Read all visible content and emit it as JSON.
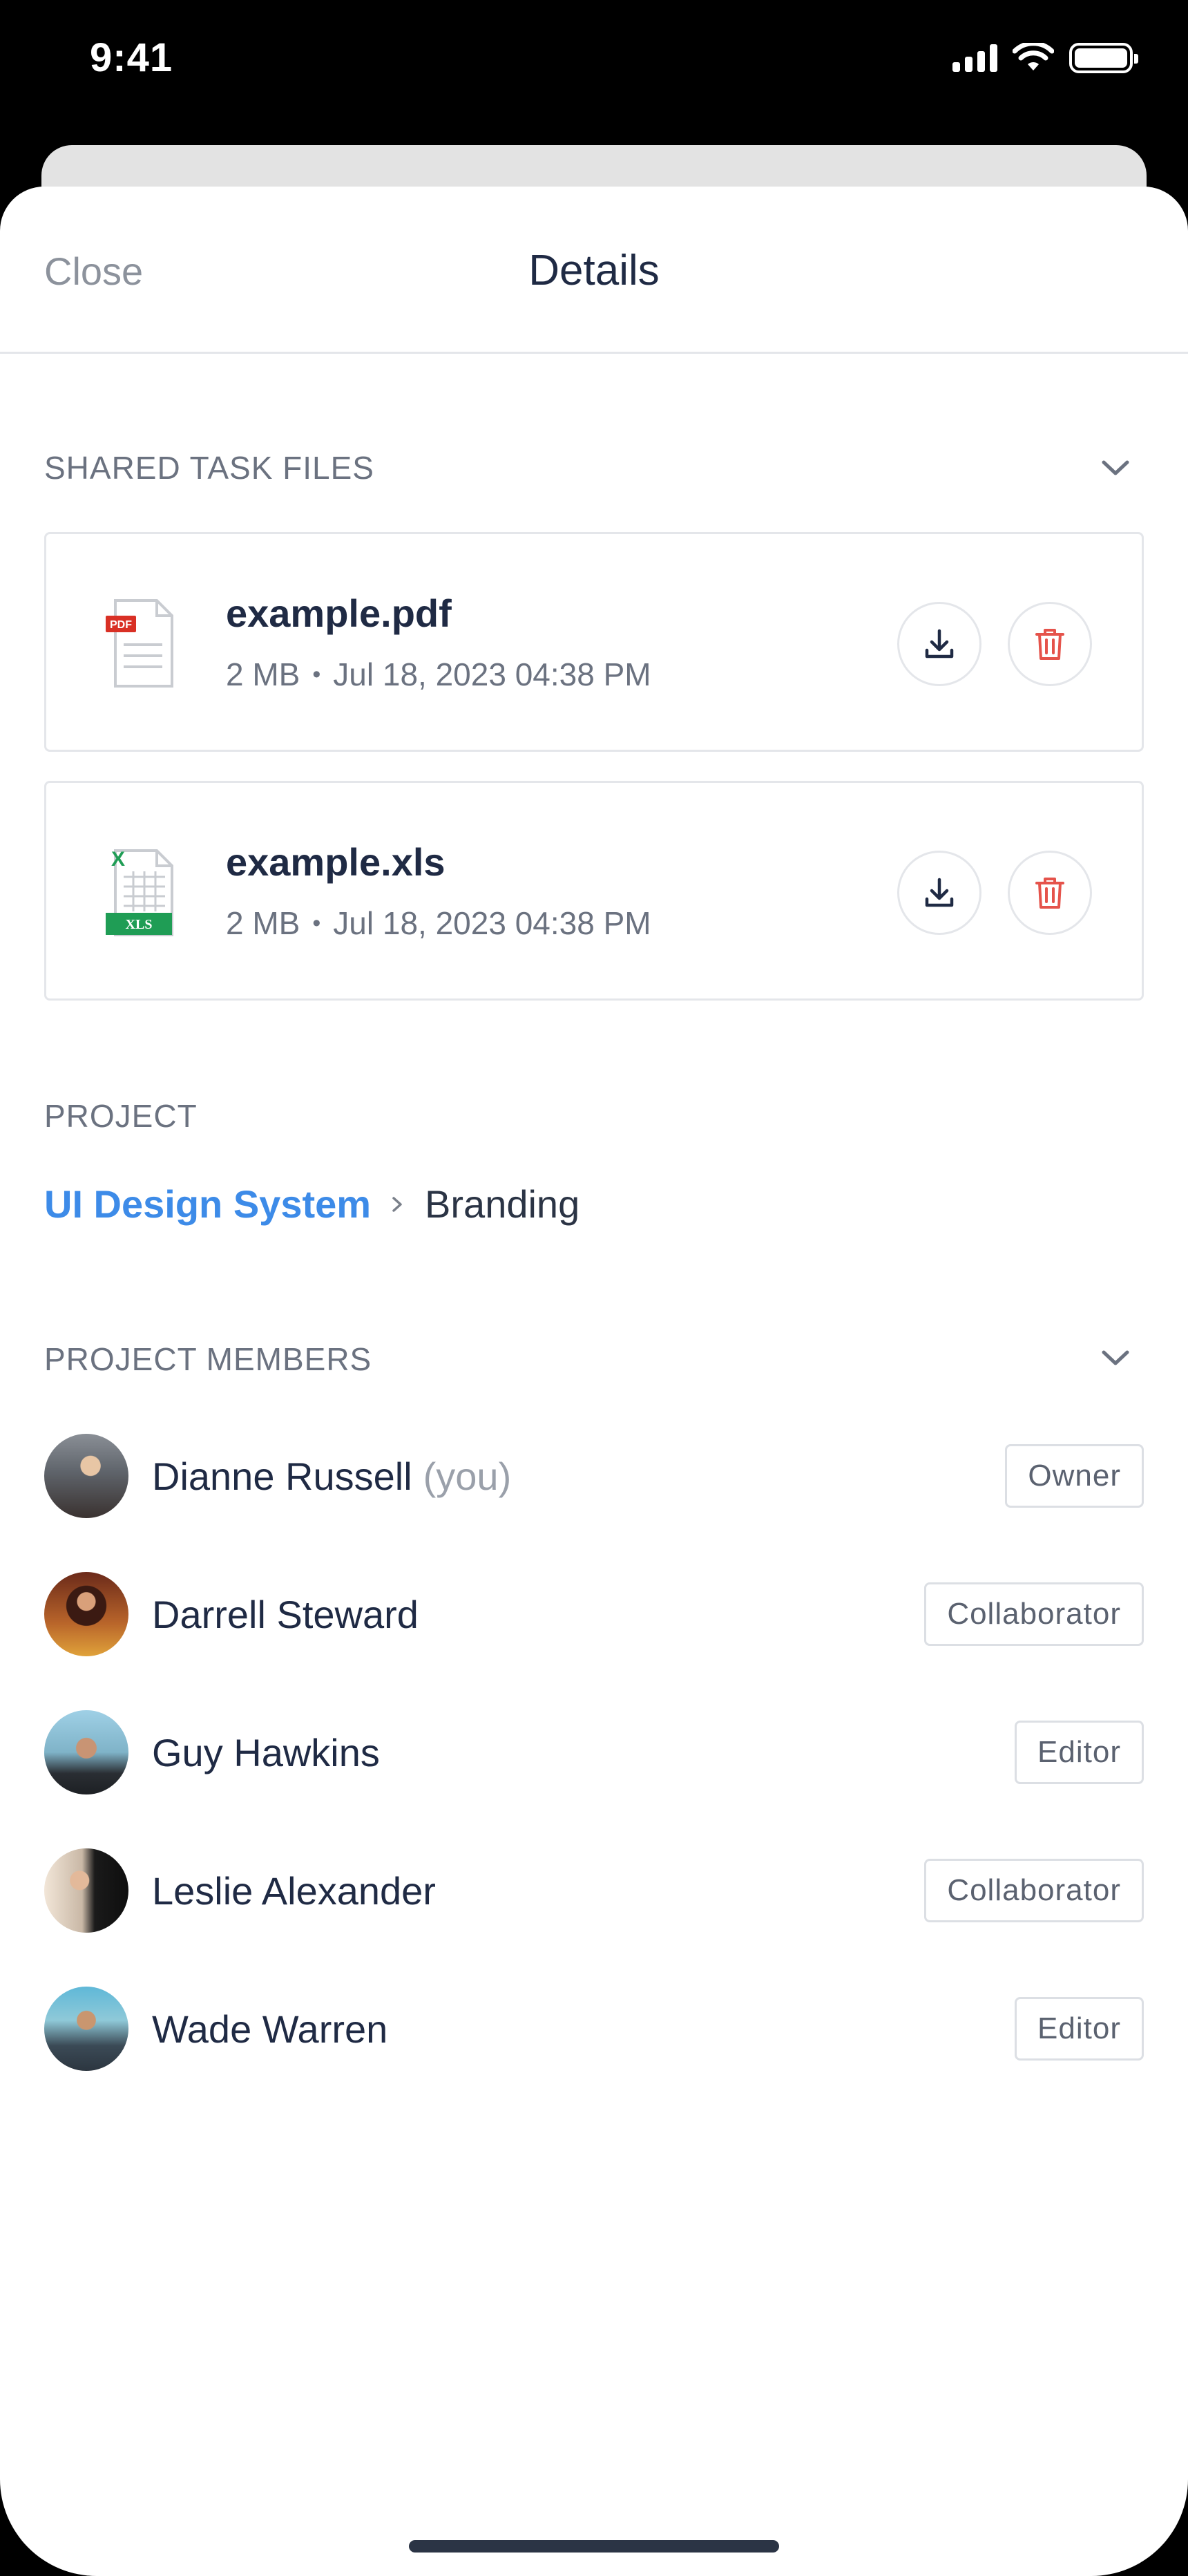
{
  "status_bar": {
    "time": "9:41"
  },
  "header": {
    "close_label": "Close",
    "title": "Details"
  },
  "files_section": {
    "label": "SHARED TASK FILES",
    "files": [
      {
        "name": "example.pdf",
        "size": "2 MB",
        "date": "Jul 18, 2023 04:38 PM",
        "icon": "pdf-file-icon"
      },
      {
        "name": "example.xls",
        "size": "2 MB",
        "date": "Jul 18, 2023 04:38 PM",
        "icon": "xls-file-icon"
      }
    ]
  },
  "project_section": {
    "label": "PROJECT",
    "project_name": "UI Design System",
    "sub_item": "Branding"
  },
  "members_section": {
    "label": "PROJECT MEMBERS",
    "members": [
      {
        "name": "Dianne Russell",
        "suffix": "(you)",
        "role": "Owner"
      },
      {
        "name": "Darrell Steward",
        "suffix": "",
        "role": "Collaborator"
      },
      {
        "name": "Guy Hawkins",
        "suffix": "",
        "role": "Editor"
      },
      {
        "name": "Leslie Alexander",
        "suffix": "",
        "role": "Collaborator"
      },
      {
        "name": "Wade Warren",
        "suffix": "",
        "role": "Editor"
      }
    ]
  },
  "colors": {
    "accent_link": "#3d8be8",
    "delete_red": "#e5534b",
    "xls_green": "#1f9d55",
    "pdf_red": "#d93025"
  }
}
